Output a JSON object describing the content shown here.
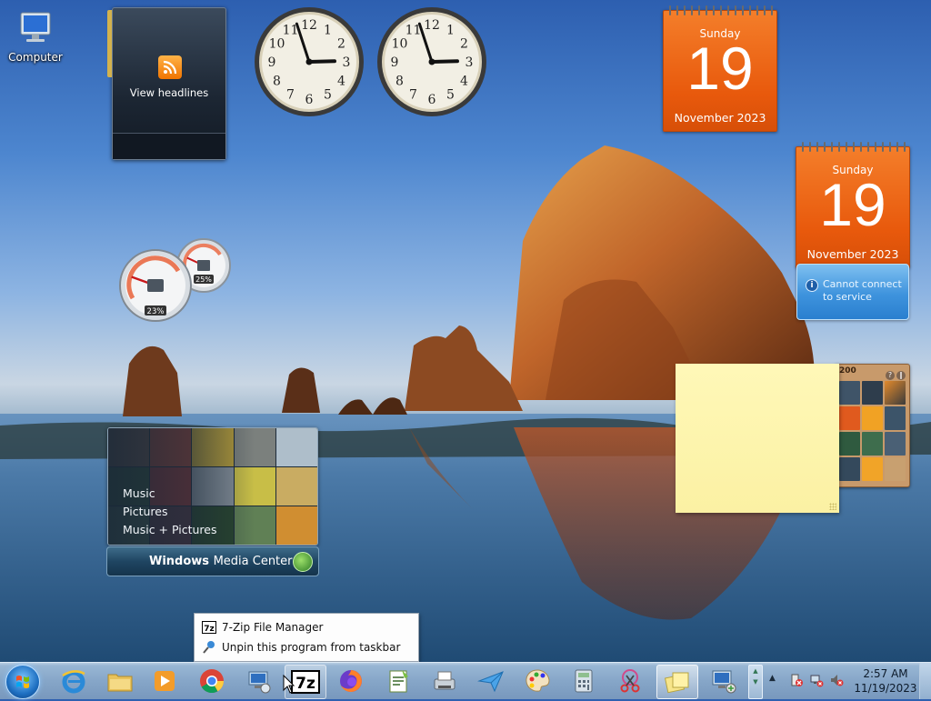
{
  "desktop": {
    "icons": [
      {
        "label": "Computer",
        "icon": "computer-icon"
      }
    ]
  },
  "gadgets": {
    "feed_headlines": {
      "label": "View headlines",
      "icon": "rss-feed-icon"
    },
    "clocks": [
      {
        "hour": 2,
        "minute": 57
      },
      {
        "hour": 2,
        "minute": 57
      }
    ],
    "calendars": [
      {
        "weekday": "Sunday",
        "day": "19",
        "month_year": "November 2023"
      },
      {
        "weekday": "Sunday",
        "day": "19",
        "month_year": "November 2023"
      }
    ],
    "weather": {
      "message_line1": "Cannot connect",
      "message_line2": "to service"
    },
    "cpu_meter": {
      "cpu_percent": "23%",
      "memory_percent": "25%",
      "cpu_value": 23,
      "memory_value": 25
    },
    "picture_puzzle": {
      "timer": "200"
    },
    "media_center": {
      "menu": [
        "Music",
        "Pictures",
        "Music + Pictures"
      ],
      "brand_light": "Windows ",
      "brand_regular": "Media Center"
    }
  },
  "jump_list": {
    "items": [
      {
        "label": "7-Zip File Manager",
        "icon": "7zip-icon"
      },
      {
        "label": "Unpin this program from taskbar",
        "icon": "unpin-icon"
      }
    ]
  },
  "taskbar": {
    "pinned": [
      {
        "name": "internet-explorer",
        "icon": "internet-explorer-icon"
      },
      {
        "name": "windows-explorer",
        "icon": "folder-icon"
      },
      {
        "name": "windows-media-player",
        "icon": "media-player-icon"
      },
      {
        "name": "google-chrome",
        "icon": "chrome-icon"
      },
      {
        "name": "remote-desktop",
        "icon": "remote-desktop-icon"
      },
      {
        "name": "7zip",
        "icon": "7zip-icon"
      },
      {
        "name": "firefox",
        "icon": "firefox-icon"
      },
      {
        "name": "notepad-plus",
        "icon": "text-editor-icon"
      },
      {
        "name": "fax-and-scan",
        "icon": "fax-icon"
      },
      {
        "name": "messenger",
        "icon": "paper-plane-icon"
      },
      {
        "name": "paint",
        "icon": "paint-palette-icon"
      },
      {
        "name": "calculator",
        "icon": "calculator-icon"
      },
      {
        "name": "snipping-tool",
        "icon": "scissors-icon"
      },
      {
        "name": "sticky-notes",
        "icon": "sticky-notes-icon"
      },
      {
        "name": "network-projector",
        "icon": "network-computer-icon"
      }
    ],
    "tray_icons": [
      "action-center-icon",
      "network-icon",
      "volume-muted-icon"
    ],
    "clock": {
      "time": "2:57 AM",
      "date": "11/19/2023"
    }
  },
  "colors": {
    "calendar_orange": "#e8590c",
    "sticky_yellow": "#fbf1a3",
    "weather_blue": "#3e93dd"
  }
}
